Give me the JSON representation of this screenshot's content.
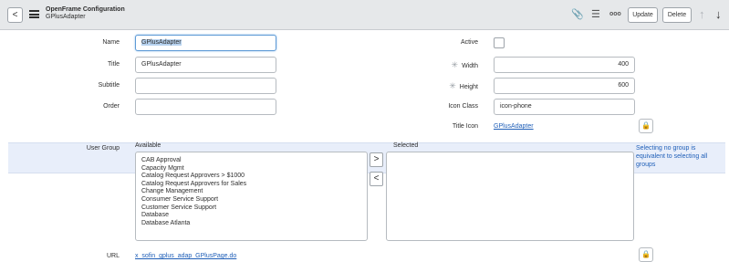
{
  "header": {
    "back_glyph": "<",
    "title": "OpenFrame Configuration",
    "subtitle": "GPlusAdapter",
    "attachment_glyph": "📎",
    "settings_glyph": "☰",
    "more_glyph": "ooo",
    "update_label": "Update",
    "delete_label": "Delete",
    "up_glyph": "↑",
    "down_glyph": "↓"
  },
  "form": {
    "name": {
      "label": "Name",
      "value": "GPlusAdapter"
    },
    "title": {
      "label": "Title",
      "value": "GPlusAdapter"
    },
    "subtitle": {
      "label": "Subtitle",
      "value": ""
    },
    "order": {
      "label": "Order",
      "value": ""
    },
    "active": {
      "label": "Active",
      "checked": false
    },
    "width": {
      "label": "Width",
      "value": "400",
      "mandatory": "✳"
    },
    "height": {
      "label": "Height",
      "value": "600",
      "mandatory": "✳"
    },
    "icon_class": {
      "label": "Icon Class",
      "value": "icon-phone"
    },
    "title_icon": {
      "label": "Title Icon",
      "value": "GPlusAdapter"
    },
    "lock_glyph": "🔒",
    "user_group": {
      "label": "User Group",
      "available_label": "Available",
      "selected_label": "Selected",
      "available": [
        "CAB Approval",
        "Capacity Mgmt",
        "Catalog Request Approvers > $1000",
        "Catalog Request Approvers for Sales",
        "Change Management",
        "Consumer Service Support",
        "Customer Service Support",
        "Database",
        "Database Atlanta"
      ],
      "add_glyph": ">",
      "remove_glyph": "<",
      "hint": "Selecting no group is equivalent to selecting all groups"
    },
    "url": {
      "label": "URL",
      "value": "x_sofin_gplus_adap_GPlusPage.do"
    }
  }
}
